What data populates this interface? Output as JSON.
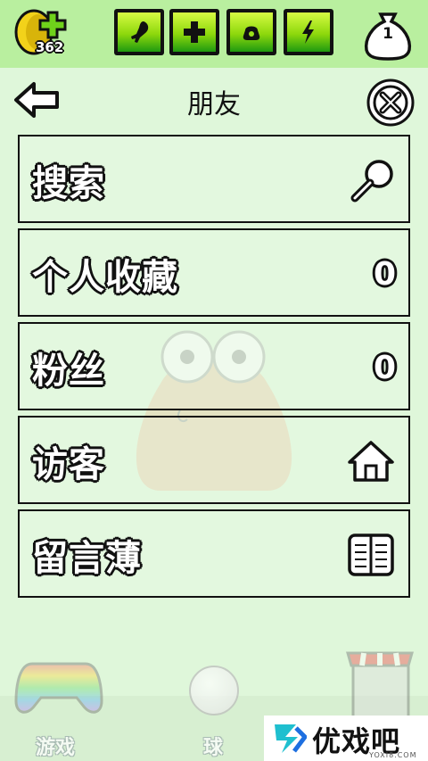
{
  "topbar": {
    "coins": "362",
    "stats": [
      {
        "name": "food",
        "icon": "drumstick-icon",
        "level": 0.85
      },
      {
        "name": "health",
        "icon": "plus-icon",
        "level": 0.85
      },
      {
        "name": "sleep",
        "icon": "lamp-icon",
        "level": 0.85
      },
      {
        "name": "energy",
        "icon": "lightning-icon",
        "level": 0.85
      }
    ],
    "bag_count": "1"
  },
  "header": {
    "title": "朋友",
    "back_icon": "back-arrow-icon",
    "close_icon": "close-icon"
  },
  "menu": {
    "items": [
      {
        "label": "搜索",
        "icon": "search-icon"
      },
      {
        "label": "个人收藏",
        "value": "0"
      },
      {
        "label": "粉丝",
        "value": "0"
      },
      {
        "label": "访客",
        "icon": "home-icon"
      },
      {
        "label": "留言薄",
        "icon": "book-icon"
      }
    ]
  },
  "bottom_nav": {
    "games_label": "游戏",
    "ball_label": "球"
  },
  "watermark": {
    "text": "优戏吧",
    "sub": "YOXI8.COM"
  },
  "colors": {
    "background": "#dff7da",
    "topbar": "#b9ef9f",
    "stat_green": "#8ed80c"
  }
}
